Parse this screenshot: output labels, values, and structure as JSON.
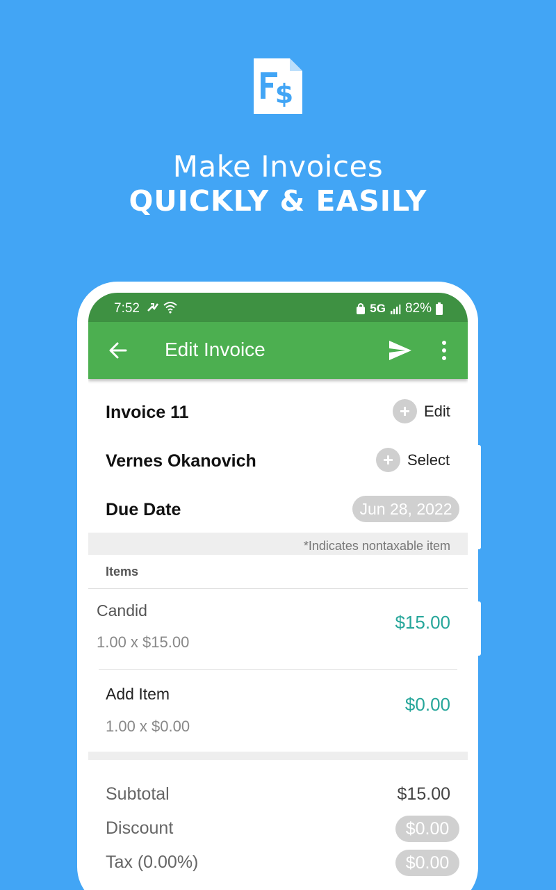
{
  "promo": {
    "logo_icon": "invoice-document-dollar-icon",
    "line1": "Make Invoices",
    "line2": "QUICKLY & EASILY"
  },
  "status_bar": {
    "time": "7:52",
    "network": "5G",
    "battery": "82%",
    "left_icons": [
      "app-notification-icon",
      "wifi-icon"
    ],
    "right_icons": [
      "secure-icon",
      "signal-icon",
      "battery-icon"
    ]
  },
  "app_bar": {
    "title": "Edit Invoice",
    "back_icon": "arrow-back-icon",
    "send_icon": "send-icon",
    "more_icon": "more-vert-icon",
    "color": "#4caf50"
  },
  "invoice": {
    "label": "Invoice 11",
    "action": "Edit"
  },
  "client": {
    "label": "Vernes Okanovich",
    "action": "Select"
  },
  "due_date": {
    "label": "Due Date",
    "value": "Jun 28, 2022"
  },
  "items_section": {
    "note": "*Indicates nontaxable item",
    "header": "Items",
    "items": [
      {
        "name": "Candid",
        "qty_price": "1.00 x $15.00",
        "amount": "$15.00"
      }
    ],
    "add_item": {
      "name": "Add Item",
      "qty_price": "1.00 x $0.00",
      "amount": "$0.00"
    }
  },
  "totals": {
    "subtotal_label": "Subtotal",
    "subtotal_value": "$15.00",
    "discount_label": "Discount",
    "discount_value": "$0.00",
    "tax_label": "Tax (0.00%)",
    "tax_value": "$0.00"
  },
  "accent_color": "#26a69a"
}
